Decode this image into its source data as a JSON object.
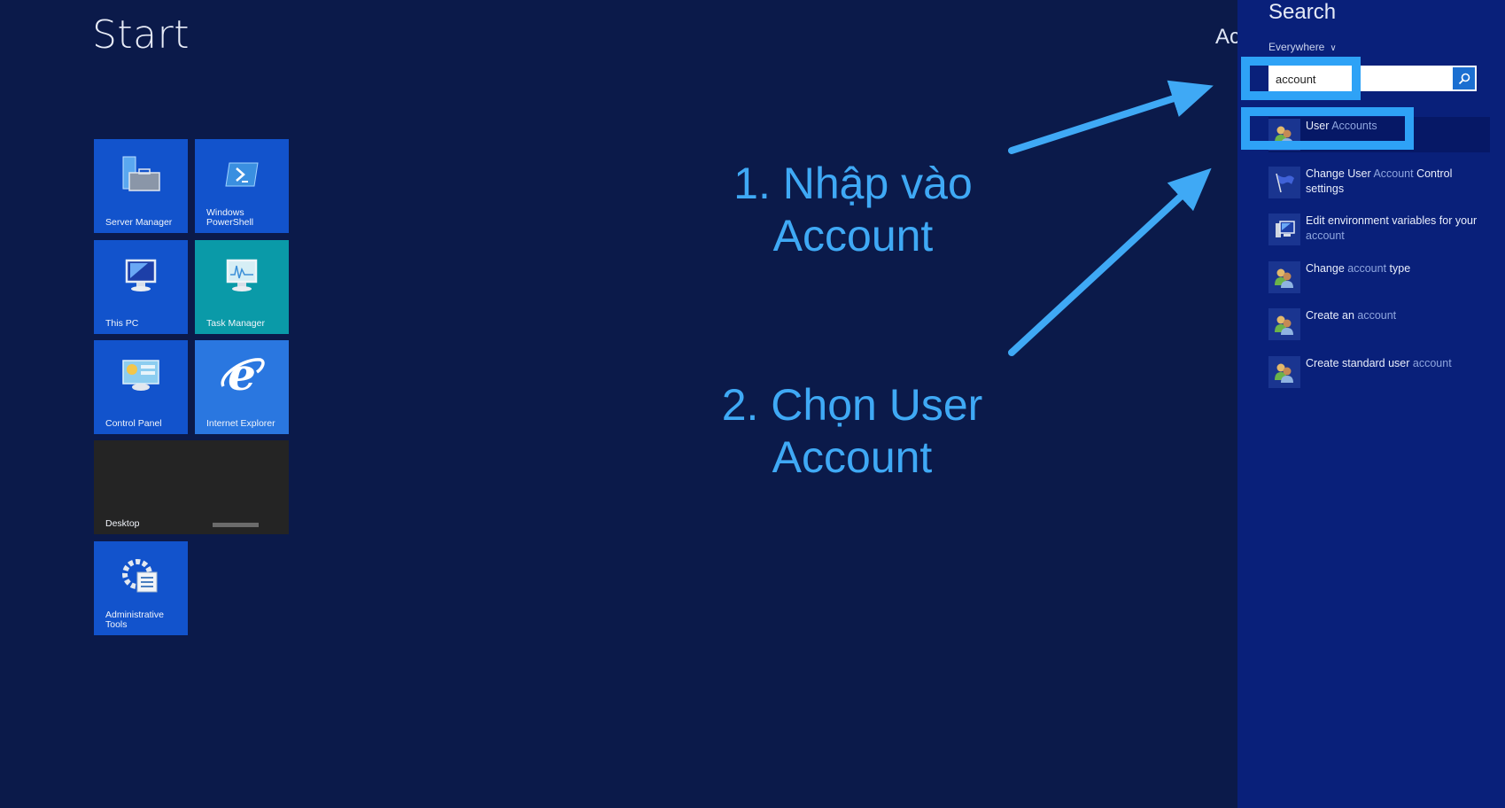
{
  "start": {
    "title": "Start",
    "user_partial": "Ac"
  },
  "tiles": [
    {
      "label": "Server Manager",
      "icon": "server-manager-icon"
    },
    {
      "label": "Windows\nPowerShell",
      "icon": "powershell-icon"
    },
    {
      "label": "This PC",
      "icon": "computer-icon"
    },
    {
      "label": "Task Manager",
      "icon": "task-manager-icon"
    },
    {
      "label": "Control Panel",
      "icon": "control-panel-icon"
    },
    {
      "label": "Internet Explorer",
      "icon": "internet-explorer-icon"
    },
    {
      "label": "Desktop",
      "icon": "desktop-icon"
    },
    {
      "label": "Administrative\nTools",
      "icon": "admin-tools-icon"
    }
  ],
  "search": {
    "title": "Search",
    "scope": "Everywhere",
    "query": "account",
    "results": [
      {
        "pre": "User ",
        "hl": "Accounts",
        "post": "",
        "icon": "users-icon"
      },
      {
        "pre": "Change User ",
        "hl": "Account",
        "post": " Control settings",
        "icon": "flag-icon"
      },
      {
        "pre": "Edit environment variables for your ",
        "hl": "account",
        "post": "",
        "icon": "computer-icon"
      },
      {
        "pre": "Change ",
        "hl": "account",
        "post": " type",
        "icon": "users-icon"
      },
      {
        "pre": "Create an ",
        "hl": "account",
        "post": "",
        "icon": "users-icon"
      },
      {
        "pre": "Create standard user ",
        "hl": "account",
        "post": "",
        "icon": "users-icon"
      }
    ]
  },
  "annotations": {
    "step1_line1": "1. Nhập vào",
    "step1_line2": "Account",
    "step2_line1": "2. Chọn User",
    "step2_line2": "Account",
    "color": "#3fa9f5"
  }
}
